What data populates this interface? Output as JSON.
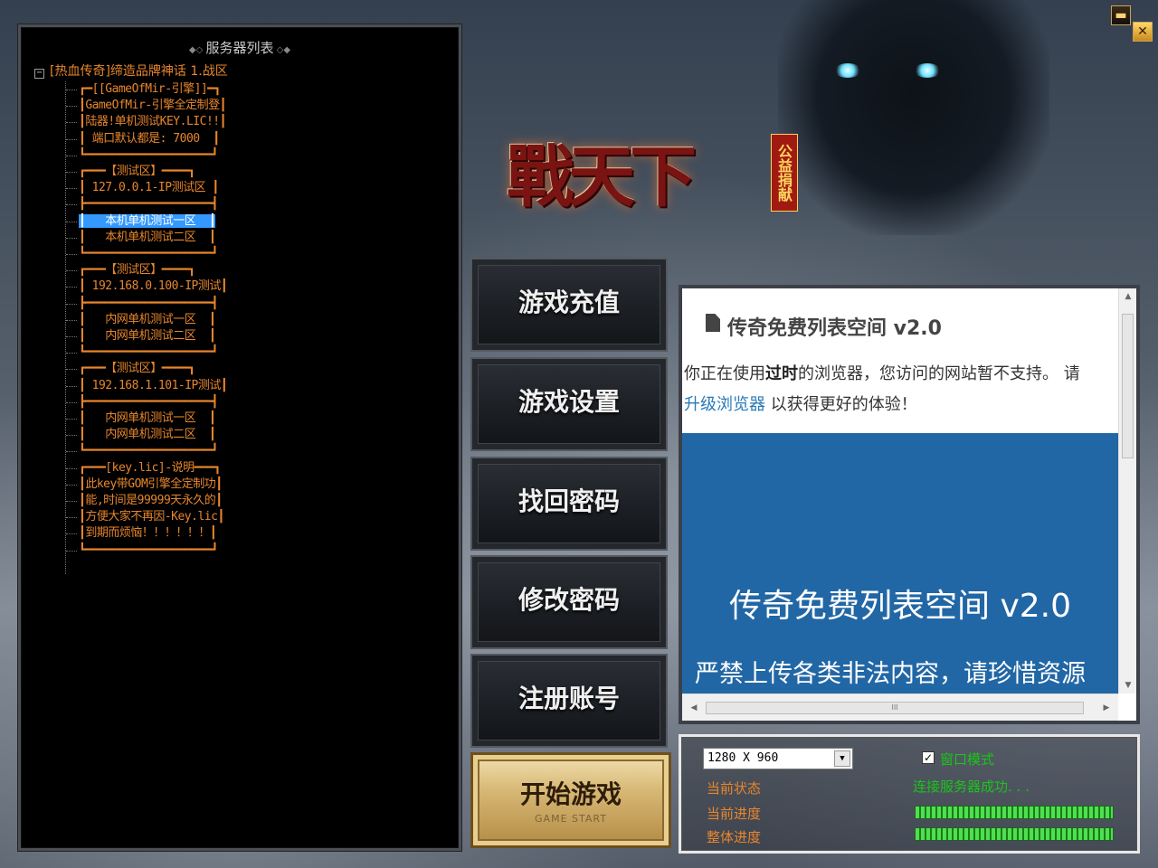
{
  "window": {
    "minimize_glyph": "▬",
    "close_glyph": "✕"
  },
  "server_list": {
    "header": "服务器列表",
    "root": "[热血传奇]缔造品牌神话 1.战区",
    "items": [
      "┏━[[GameOfMir-引擎]]━┓",
      "┃GameOfMir-引擎全定制登┃",
      "┃陆器!单机测试KEY.LIC!!┃",
      "┃ 端口默认都是: 7000  ┃",
      "┗━━━━━━━━━━━━━━━━━━━┛",
      "┏━━━【测试区】━━━━┓",
      "┃ 127.0.0.1-IP测试区 ┃",
      "┣━━━━━━━━━━━━━━━━━━━┫",
      "┃   本机单机测试一区  ┃",
      "┃   本机单机测试二区  ┃",
      "┗━━━━━━━━━━━━━━━━━━━┛",
      "┏━━━【测试区】━━━━┓",
      "┃ 192.168.0.100-IP测试┃",
      "┣━━━━━━━━━━━━━━━━━━━┫",
      "┃   内网单机测试一区  ┃",
      "┃   内网单机测试二区  ┃",
      "┗━━━━━━━━━━━━━━━━━━━┛",
      "┏━━━【测试区】━━━━┓",
      "┃ 192.168.1.101-IP测试┃",
      "┣━━━━━━━━━━━━━━━━━━━┫",
      "┃   内网单机测试一区  ┃",
      "┃   内网单机测试二区  ┃",
      "┗━━━━━━━━━━━━━━━━━━━┛",
      "┏━━━[key.lic]-说明━━━┓",
      "┃此key带GOM引擎全定制功┃",
      "┃能,时间是99999天永久的┃",
      "┃方便大家不再因-Key.lic┃",
      "┃到期而烦恼！！！！！！┃",
      "┗━━━━━━━━━━━━━━━━━━━┛"
    ],
    "selected_item_index": 8
  },
  "logo": {
    "title": "戰天下",
    "badge": "公益捐献"
  },
  "menu": {
    "recharge": "游戏充值",
    "settings": "游戏设置",
    "recover_password": "找回密码",
    "change_password": "修改密码",
    "register": "注册账号",
    "start": "开始游戏",
    "start_sub": "GAME START"
  },
  "browser": {
    "title": "传奇免费列表空间 v2.0",
    "warning_prefix": "你正在使用",
    "warning_bold": "过时",
    "warning_mid": "的浏览器，您访问的网站暂不支持。 请",
    "warning_link": "升级浏览器",
    "warning_suffix": " 以获得更好的体验！",
    "hero_title": "传奇免费列表空间 v2.0",
    "hero_sub": "严禁上传各类非法内容，请珍惜资源",
    "scroll_grip": "III"
  },
  "status": {
    "resolution": "1280 X 960",
    "window_mode_label": "窗口模式",
    "window_mode_checked": true,
    "state_label": "当前状态",
    "state_value": "连接服务器成功. . .",
    "progress_label": "当前进度",
    "progress_value": 1.0,
    "total_label": "整体进度",
    "total_value": 1.0
  }
}
